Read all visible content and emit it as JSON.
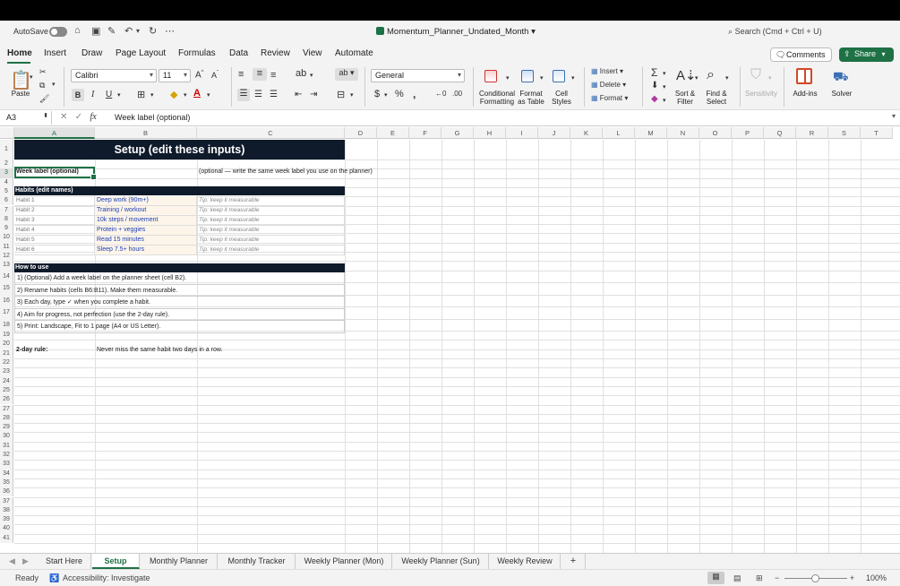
{
  "titlebar": {
    "autosave_label": "AutoSave",
    "file_name": "Momentum_Planner_Undated_Month",
    "search_placeholder": "Search (Cmd + Ctrl + U)"
  },
  "ribbon_tabs": [
    "Home",
    "Insert",
    "Draw",
    "Page Layout",
    "Formulas",
    "Data",
    "Review",
    "View",
    "Automate"
  ],
  "active_ribbon_tab": "Home",
  "buttons": {
    "comments": "Comments",
    "share": "Share"
  },
  "ribbon": {
    "paste": "Paste",
    "font_name": "Calibri",
    "font_size": "11",
    "number_format": "General",
    "conditional_formatting": [
      "Conditional",
      "Formatting"
    ],
    "format_as_table": [
      "Format",
      "as Table"
    ],
    "cell_styles": [
      "Cell",
      "Styles"
    ],
    "insert": "Insert",
    "delete": "Delete",
    "format": "Format",
    "sort_filter": [
      "Sort &",
      "Filter"
    ],
    "find_select": [
      "Find &",
      "Select"
    ],
    "sensitivity": "Sensitivity",
    "addins": "Add-ins",
    "solver": "Solver"
  },
  "formula_bar": {
    "name_box": "A3",
    "content": "Week label (optional)"
  },
  "columns": [
    "A",
    "B",
    "C",
    "D",
    "E",
    "F",
    "G",
    "H",
    "I",
    "J",
    "K",
    "L",
    "M",
    "N",
    "O",
    "P",
    "Q",
    "R",
    "S",
    "T"
  ],
  "rows": [
    "1",
    "2",
    "3",
    "4",
    "5",
    "6",
    "7",
    "8",
    "9",
    "10",
    "11",
    "12",
    "13",
    "14",
    "15",
    "16",
    "17",
    "18",
    "19",
    "20",
    "21",
    "22",
    "23",
    "24",
    "25",
    "26",
    "27",
    "28",
    "29",
    "30",
    "31",
    "32",
    "33",
    "34",
    "35",
    "36",
    "37",
    "38",
    "39",
    "40",
    "41"
  ],
  "sheet": {
    "title": "Setup (edit these inputs)",
    "week_label": "Week label (optional)",
    "week_note": "(optional — write the same week label you use on the planner)",
    "habits_header": "Habits (edit names)",
    "habits": [
      {
        "label": "Habit 1",
        "name": "Deep work (90m+)",
        "tip": "Tip: keep it measurable"
      },
      {
        "label": "Habit 2",
        "name": "Training / workout",
        "tip": "Tip: keep it measurable"
      },
      {
        "label": "Habit 3",
        "name": "10k steps / movement",
        "tip": "Tip: keep it measurable"
      },
      {
        "label": "Habit 4",
        "name": "Protein + veggies",
        "tip": "Tip: keep it measurable"
      },
      {
        "label": "Habit 5",
        "name": "Read 15 minutes",
        "tip": "Tip: keep it measurable"
      },
      {
        "label": "Habit 6",
        "name": "Sleep 7.5+ hours",
        "tip": "Tip: keep it measurable"
      }
    ],
    "howto_header": "How to use",
    "howto": [
      "1) (Optional) Add a week label on the planner sheet (cell B2).",
      "2) Rename habits (cells B6:B11). Make them measurable.",
      "3) Each day, type ✓ when you complete a habit.",
      "4) Aim for progress, not perfection (use the 2-day rule).",
      "5) Print: Landscape, Fit to 1 page (A4 or US Letter)."
    ],
    "rule_label": "2-day rule:",
    "rule_text": "Never miss the same habit two days in a row."
  },
  "sheet_tabs": [
    "Start Here",
    "Setup",
    "Monthly Planner",
    "Monthly Tracker",
    "Weekly Planner (Mon)",
    "Weekly Planner (Sun)",
    "Weekly Review"
  ],
  "active_sheet": "Setup",
  "status": {
    "ready": "Ready",
    "accessibility": "Accessibility: Investigate",
    "zoom": "100%"
  },
  "colors": {
    "accent": "#1e7145",
    "header_dark": "#0f1a2a",
    "habit_blue": "#1a3eb8"
  }
}
